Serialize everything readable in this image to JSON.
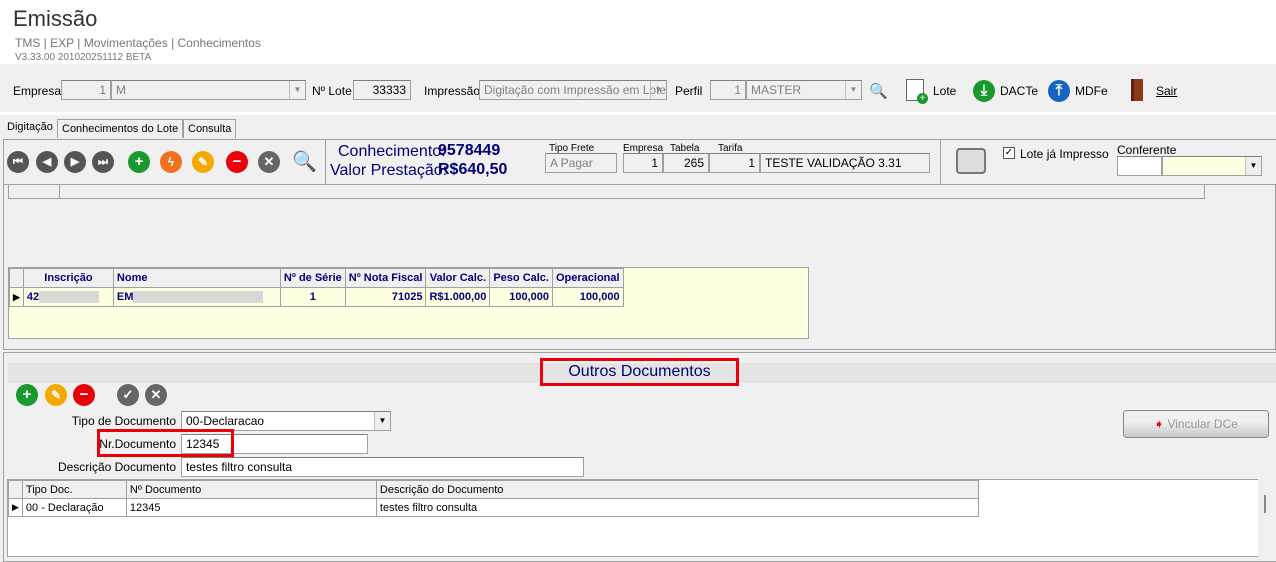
{
  "header": {
    "title": "Emissão",
    "breadcrumb": "TMS | EXP | Movimentações | Conhecimentos",
    "version": "V3.33.00 201020251112 BETA"
  },
  "topbar": {
    "empresa_label": "Empresa",
    "empresa_code": "1",
    "empresa_name": "M",
    "lote_label": "Nº Lote",
    "lote_value": "33333",
    "impressao_label": "Impressão",
    "impressao_value": "Digitação com Impressão em Lote",
    "perfil_label": "Perfil",
    "perfil_code": "1",
    "perfil_name": "MASTER",
    "lote_button": "Lote",
    "dacte_button": "DACTe",
    "mdfe_button": "MDFe",
    "sair_button": "Sair"
  },
  "tabs": [
    {
      "label": "Digitação",
      "active": true
    },
    {
      "label": "Conhecimentos do Lote"
    },
    {
      "label": "Consulta"
    }
  ],
  "toolbar": {
    "conhecimento_label": "Conhecimento:",
    "conhecimento_value": "9578449",
    "valor_label": "Valor Prestação:",
    "valor_value": "R$640,50",
    "tipo_frete_label": "Tipo Frete",
    "tipo_frete_value": "A Pagar",
    "empresa_label": "Empresa",
    "empresa_value": "1",
    "tabela_label": "Tabela",
    "tabela_value": "265",
    "tarifa_label": "Tarifa",
    "tarifa_code": "1",
    "tarifa_name": "TESTE VALIDAÇÃO 3.31",
    "lote_impresso_label": "Lote já Impresso",
    "lote_impresso_checked": true,
    "conferente_label": "Conferente"
  },
  "notes_grid": {
    "columns": [
      "Inscrição",
      "Nome",
      "Nº de Série",
      "Nº Nota Fiscal",
      "Valor Calc.",
      "Peso Calc.",
      "Operacional"
    ],
    "rows": [
      [
        "42",
        "EM",
        "1",
        "71025",
        "R$1.000,00",
        "100,000",
        "100,000"
      ]
    ]
  },
  "outros": {
    "title": "Outros Documentos",
    "tipo_label": "Tipo de Documento",
    "tipo_value": "00-Declaracao",
    "nr_label": "Nr.Documento",
    "nr_value": "12345",
    "desc_label": "Descrição Documento",
    "desc_value": "testes filtro consulta",
    "vincular_button": "Vincular DCe"
  },
  "docs_grid": {
    "columns": [
      "Tipo Doc.",
      "Nº Documento",
      "Descrição do Documento"
    ],
    "rows": [
      [
        "00 - Declaração",
        "12345",
        "testes filtro consulta"
      ]
    ]
  },
  "colors": {
    "highlight": "#e8000b",
    "accent_text": "#00007a",
    "grid_bg": "#ffffe1"
  }
}
